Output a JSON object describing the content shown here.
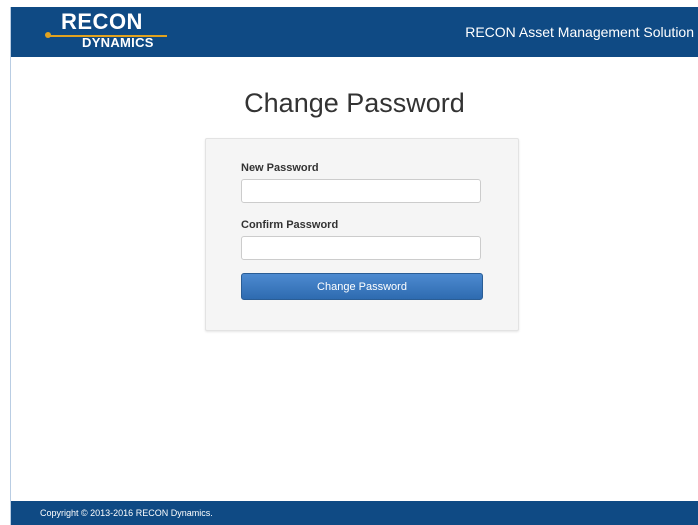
{
  "header": {
    "logo_top": "RECON",
    "logo_bottom": "DYNAMICS",
    "app_title": "RECON Asset Management Solution"
  },
  "page_title": "Change Password",
  "form": {
    "new_password_label": "New Password",
    "new_password_value": "",
    "confirm_password_label": "Confirm Password",
    "confirm_password_value": "",
    "submit_label": "Change Password"
  },
  "footer": {
    "copyright": "Copyright © 2013-2016 RECON Dynamics."
  },
  "colors": {
    "header_bg": "#0f4a84",
    "button_bg": "#3a78bf",
    "logo_accent": "#e1a21f"
  }
}
